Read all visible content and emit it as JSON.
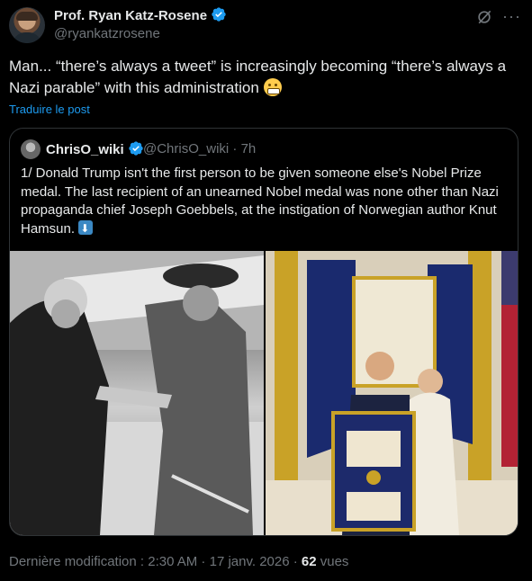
{
  "author": {
    "name": "Prof. Ryan Katz-Rosene",
    "handle": "@ryankatzrosene"
  },
  "post": {
    "text": "Man... “there’s always a tweet” is increasingly becoming “there’s always a Nazi parable” with this administration",
    "translate_label": "Traduire le post"
  },
  "quoted": {
    "name": "ChrisO_wiki",
    "handle_time": "@ChrisO_wiki · 7h",
    "text": "1/ Donald Trump isn't the first person to be given someone else's Nobel Prize medal. The last recipient of an unearned Nobel medal was none other than Nazi propaganda chief Joseph Goebbels, at the instigation of Norwegian author Knut Hamsun."
  },
  "meta": {
    "edited": "Dernière modification : 2:30 AM · 17 janv. 2026 · ",
    "views_count": "62",
    "views_label": " vues"
  },
  "icons": [
    "verified-badge-icon",
    "grok-icon",
    "more-icon",
    "grimacing-emoji",
    "down-arrow-emoji"
  ],
  "colors": {
    "link": "#1d9bf0",
    "verified": "#1d9bf0",
    "muted": "#71767b"
  }
}
